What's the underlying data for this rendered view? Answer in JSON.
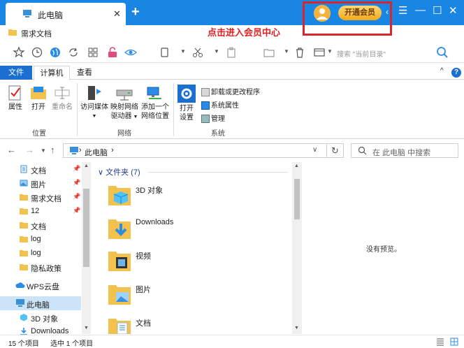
{
  "titlebar": {
    "tab_title": "此电脑",
    "tab_close": "✕",
    "new_tab": "+",
    "vip_button": "开通会员",
    "annotation": "点击进入会员中心",
    "collapse": "‹",
    "menu": "☰",
    "minimize": "—",
    "maximize": "☐",
    "close": "✕"
  },
  "breadcrumb": {
    "label": "需求文档"
  },
  "toolbar": {
    "search_placeholder": "搜索 \"当前目录\""
  },
  "ribbon_tabs": {
    "file": "文件",
    "computer": "计算机",
    "view": "查看",
    "help": "?"
  },
  "ribbon": {
    "location_group": "位置",
    "network_group": "网络",
    "system_group": "系统",
    "properties": "属性",
    "open": "打开",
    "rename": "重命名",
    "access_media": "访问媒体",
    "map_drive_1": "映射网络",
    "map_drive_2": "驱动器",
    "add_location_1": "添加一个",
    "add_location_2": "网络位置",
    "open_settings_1": "打开",
    "open_settings_2": "设置",
    "uninstall": "卸载或更改程序",
    "system_props": "系统属性",
    "manage": "管理"
  },
  "address": {
    "path": "此电脑",
    "path_sep": "›",
    "search_placeholder": "在 此电脑 中搜索"
  },
  "nav_pane": {
    "items": [
      {
        "label": "文档",
        "pinned": true
      },
      {
        "label": "图片",
        "pinned": true
      },
      {
        "label": "需求文档",
        "pinned": true
      },
      {
        "label": "12",
        "pinned": true
      },
      {
        "label": "文档",
        "pinned": false
      },
      {
        "label": "log",
        "pinned": false
      },
      {
        "label": "log",
        "pinned": false
      },
      {
        "label": "隐私政策",
        "pinned": false
      },
      {
        "label": "WPS云盘",
        "pinned": false
      },
      {
        "label": "此电脑",
        "pinned": false,
        "selected": true
      },
      {
        "label": "3D 对象",
        "pinned": false
      },
      {
        "label": "Downloads",
        "pinned": false
      }
    ]
  },
  "content": {
    "group_header": "文件夹 (7)",
    "folders": [
      {
        "name": "3D 对象",
        "icon": "3d-objects-icon"
      },
      {
        "name": "Downloads",
        "icon": "downloads-icon"
      },
      {
        "name": "视频",
        "icon": "videos-icon"
      },
      {
        "name": "图片",
        "icon": "pictures-icon"
      },
      {
        "name": "文档",
        "icon": "documents-icon"
      }
    ]
  },
  "preview": {
    "text": "没有预览。"
  },
  "status": {
    "item_count": "15 个项目",
    "selected": "选中 1 个项目"
  },
  "colors": {
    "titlebar": "#1a86e4",
    "accent": "#1a6fd0",
    "annotation": "#e02020",
    "folder": "#f2c14e"
  }
}
